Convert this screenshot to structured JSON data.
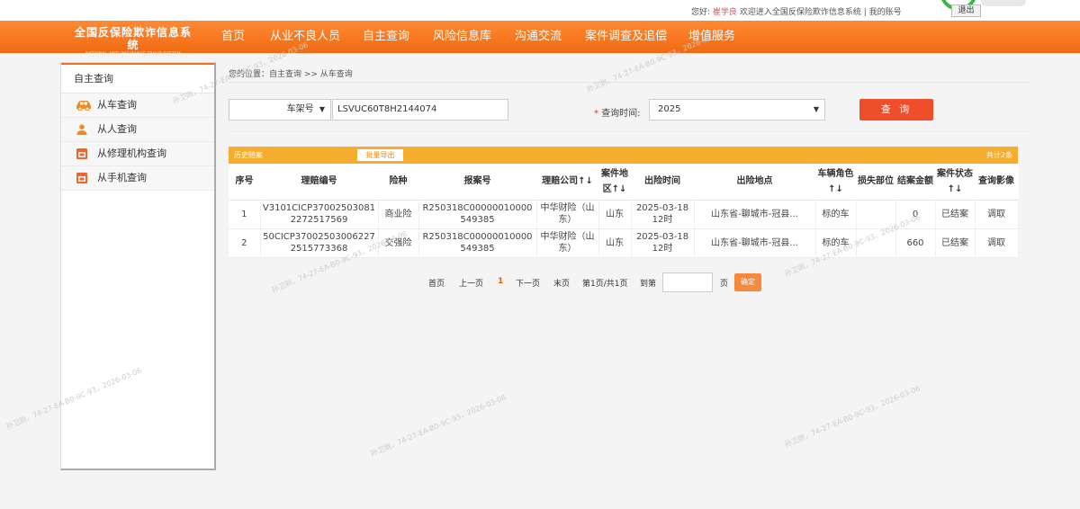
{
  "topbar": {
    "greeting": "您好:",
    "username": "崔学良",
    "welcome": "欢迎进入全国反保险欺诈信息系统",
    "separator": "|",
    "my_account": "我的账号",
    "logout": "退出"
  },
  "logo": {
    "cn": "全国反保险欺诈信息系统",
    "en": "NATIONAL ANTI INSURANCE FRAUD SYSTEM"
  },
  "nav": [
    "首页",
    "从业不良人员",
    "自主查询",
    "风险信息库",
    "沟通交流",
    "案件调查及追偿",
    "增值服务"
  ],
  "sidebar": {
    "title": "自主查询",
    "items": [
      {
        "label": "从车查询",
        "icon": "car-icon"
      },
      {
        "label": "从人查询",
        "icon": "person-icon"
      },
      {
        "label": "从修理机构查询",
        "icon": "repair-icon"
      },
      {
        "label": "从手机查询",
        "icon": "phone-icon"
      }
    ]
  },
  "breadcrumb": "您的位置：自主查询 >> 从车查询",
  "search": {
    "type_value": "车架号",
    "vin_value": "LSVUC60T8H2144074",
    "time_required_mark": "*",
    "time_label": "查询时间:",
    "time_value": "2025",
    "query_button": "查 询"
  },
  "table": {
    "section_title": "历史赔案",
    "export_button": "批量导出",
    "total": "共计2条",
    "headers": [
      "序号",
      "理赔编号",
      "险种",
      "报案号",
      "理赔公司↑↓",
      "案件地区↑↓",
      "出险时间",
      "出险地点",
      "车辆角色↑↓",
      "损失部位",
      "结案金额",
      "案件状态↑↓",
      "查询影像"
    ],
    "rows": [
      [
        "1",
        "V3101CICP370025030812272517569",
        "商业险",
        "R250318C00000010000549385",
        "中华财险（山东）",
        "山东",
        "2025-03-18 12时",
        "山东省-聊城市-冠县...",
        "标的车",
        "",
        "0",
        "已结案",
        "调取"
      ],
      [
        "2",
        "50CICP370025030062272515773368",
        "交强险",
        "R250318C00000010000549385",
        "中华财险（山东）",
        "山东",
        "2025-03-18 12时",
        "山东省-聊城市-冠县...",
        "标的车",
        "",
        "660",
        "已结案",
        "调取"
      ]
    ]
  },
  "pager": {
    "first": "首页",
    "prev": "上一页",
    "current": "1",
    "next": "下一页",
    "last": "末页",
    "info": "第1页/共1页",
    "goto_label": "到第",
    "page_unit": "页",
    "confirm": "确定"
  },
  "watermark": {
    "text_a": "孙卫刚，74-27-EA-B0-9C-93，2026-03-06",
    "text_b": "孙卫刚，74-27-EA-B0-9C-93，2026-03-06"
  }
}
